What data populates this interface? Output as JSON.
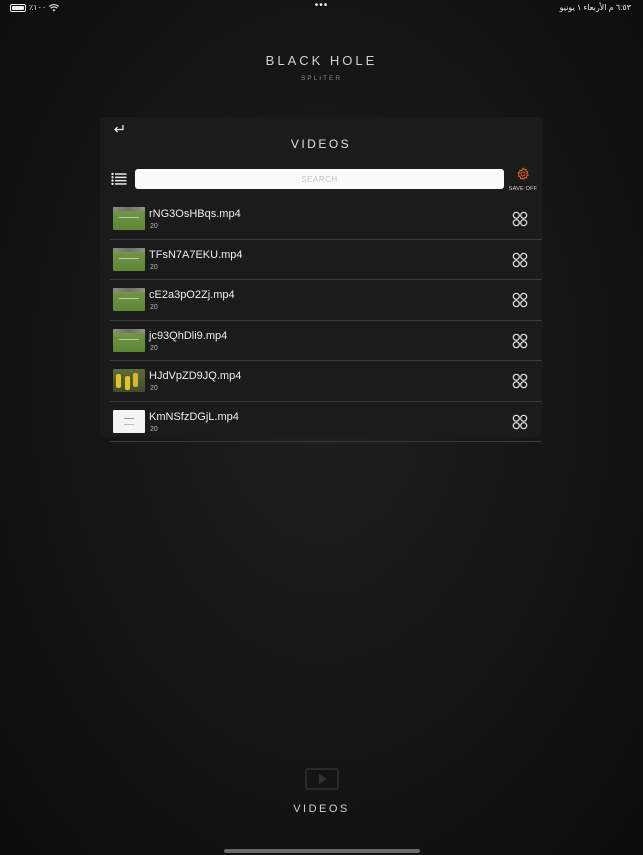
{
  "status": {
    "battery": "٪١٠٠",
    "dots": "•••",
    "time_date": "٦:٥٣ م  الأربعاء ١ يونيو"
  },
  "app": {
    "title": "BLACK HOLE",
    "subtitle": "SPLITER"
  },
  "panel": {
    "title": "VIDEOS",
    "search_placeholder": "SEARCH",
    "settings_label": "SAVE OFF",
    "settings_color": "#e0622a"
  },
  "videos": [
    {
      "name": "rNG3OsHBqs.mp4",
      "duration": "20",
      "thumb": "field"
    },
    {
      "name": "TFsN7A7EKU.mp4",
      "duration": "20",
      "thumb": "field"
    },
    {
      "name": "cE2a3pO2Zj.mp4",
      "duration": "20",
      "thumb": "field"
    },
    {
      "name": "jc93QhDli9.mp4",
      "duration": "20",
      "thumb": "field"
    },
    {
      "name": "HJdVpZD9JQ.mp4",
      "duration": "20",
      "thumb": "dark"
    },
    {
      "name": "KmNSfzDGjL.mp4",
      "duration": "20",
      "thumb": "white"
    }
  ],
  "bottom": {
    "label": "VIDEOS"
  },
  "icons": {
    "back": "return-arrow-icon",
    "list": "list-icon",
    "settings": "gear-icon",
    "row_action": "four-circles-icon"
  }
}
